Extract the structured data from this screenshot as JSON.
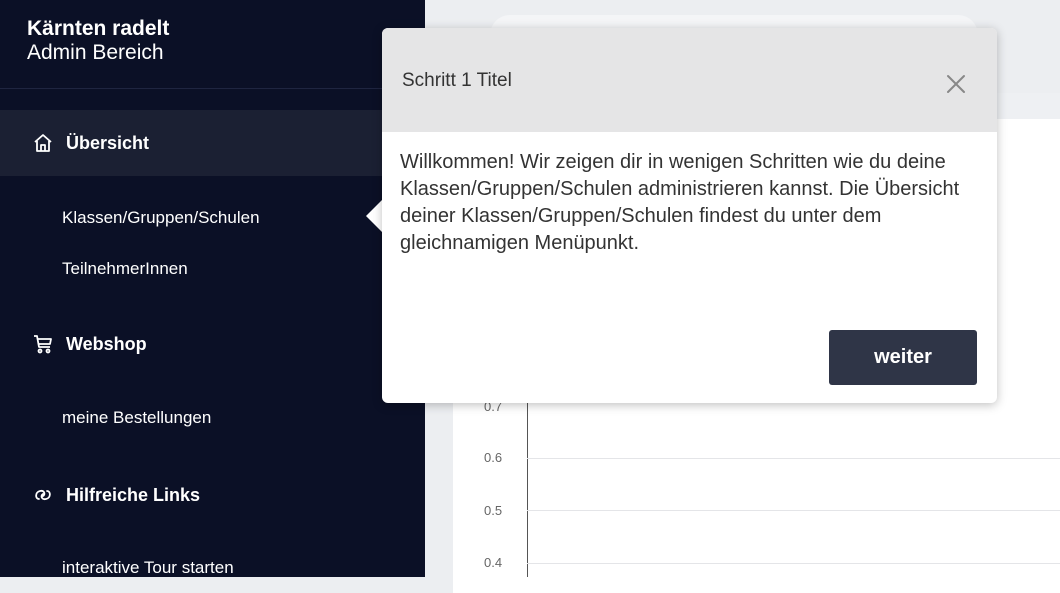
{
  "sidebar": {
    "brand_title": "Kärnten radelt",
    "brand_subtitle": "Admin Bereich",
    "sections": [
      {
        "label": "Übersicht",
        "icon": "home-icon",
        "active": true
      },
      {
        "label": "Webshop",
        "icon": "cart-icon",
        "active": false
      },
      {
        "label": "Hilfreiche Links",
        "icon": "link-icon",
        "active": false
      }
    ],
    "items": {
      "klassen": "Klassen/Gruppen/Schulen",
      "teilnehmer": "TeilnehmerInnen",
      "bestellungen": "meine Bestellungen",
      "tour": "interaktive Tour starten"
    }
  },
  "chart": {
    "ticks": [
      "0.7",
      "0.6",
      "0.5",
      "0.4"
    ]
  },
  "popover": {
    "title": "Schritt 1 Titel",
    "body": "Willkommen! Wir zeigen dir in wenigen Schritten wie du deine Klassen/Gruppen/Schulen administrieren kannst. Die Übersicht deiner Klassen/Gruppen/Schulen findest du unter dem gleichnamigen Menüpunkt.",
    "button_label": "weiter",
    "close_icon": "close-icon"
  },
  "colors": {
    "sidebar_bg": "#0b1026",
    "active_section_bg": "#1b2033",
    "button_bg": "#2f3547",
    "popover_head_bg": "#e5e5e6"
  }
}
